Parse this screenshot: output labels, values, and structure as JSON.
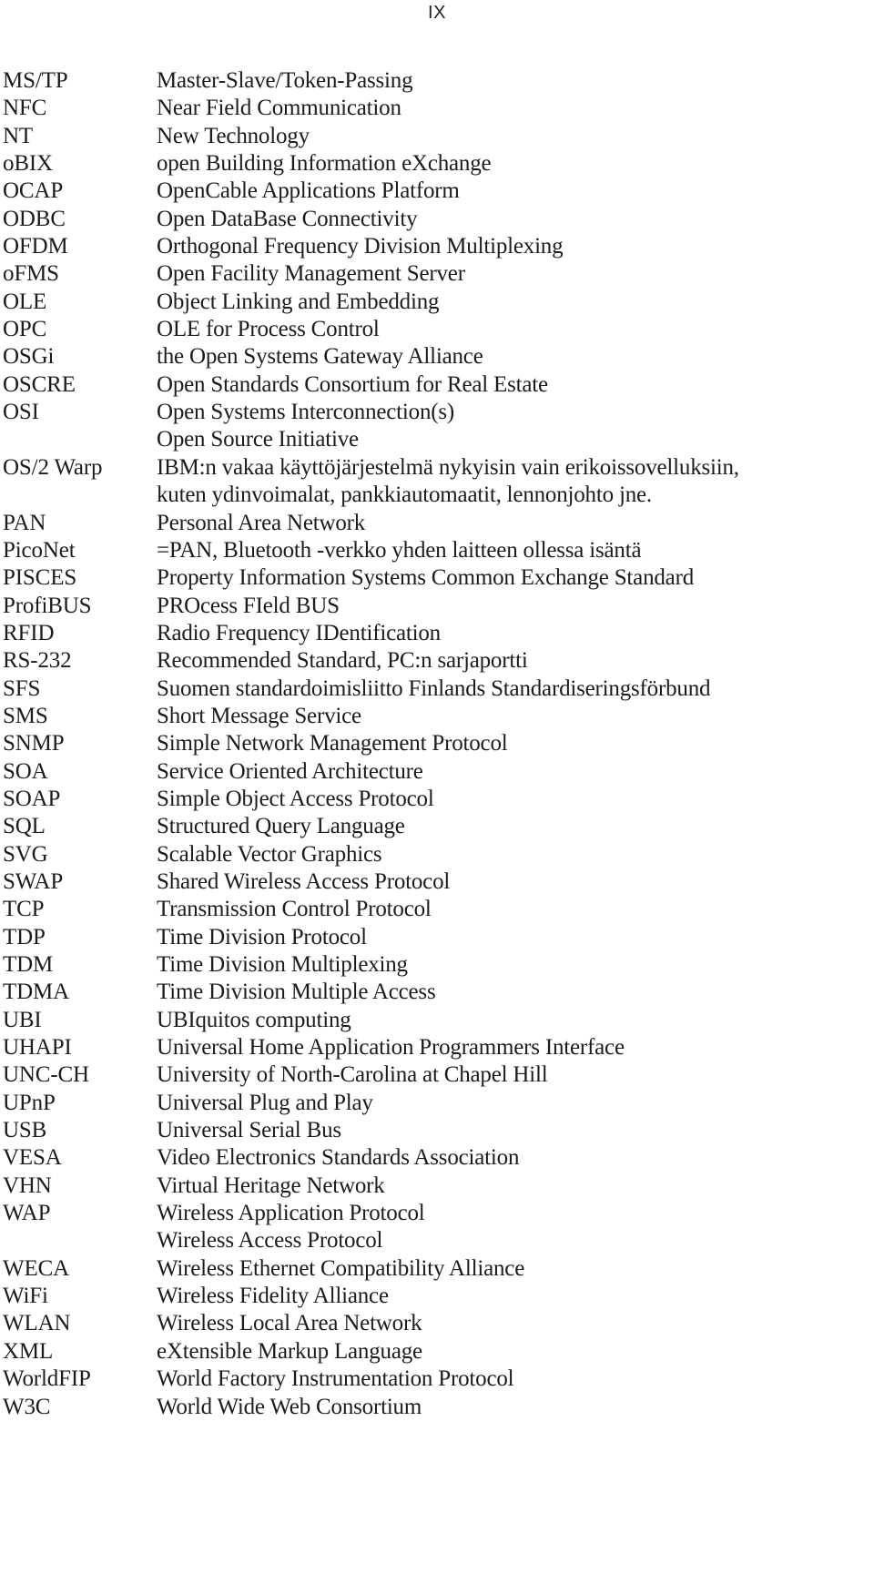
{
  "page": {
    "folio": "IX"
  },
  "glossary": {
    "entries": [
      {
        "abbr": "MS/TP",
        "desc": "Master-Slave/Token-Passing",
        "continuation": false
      },
      {
        "abbr": "NFC",
        "desc": "Near Field Communication",
        "continuation": false
      },
      {
        "abbr": "NT",
        "desc": "New Technology",
        "continuation": false
      },
      {
        "abbr": "oBIX",
        "desc": "open Building Information eXchange",
        "continuation": false
      },
      {
        "abbr": "OCAP",
        "desc": "OpenCable Applications Platform",
        "continuation": false
      },
      {
        "abbr": "ODBC",
        "desc": "Open DataBase Connectivity",
        "continuation": false
      },
      {
        "abbr": "OFDM",
        "desc": "Orthogonal Frequency Division Multiplexing",
        "continuation": false
      },
      {
        "abbr": "oFMS",
        "desc": "Open Facility Management Server",
        "continuation": false
      },
      {
        "abbr": "OLE",
        "desc": "Object Linking and Embedding",
        "continuation": false
      },
      {
        "abbr": "OPC",
        "desc": "OLE for Process Control",
        "continuation": false
      },
      {
        "abbr": "OSGi",
        "desc": "the Open Systems Gateway Alliance",
        "continuation": false
      },
      {
        "abbr": "OSCRE",
        "desc": "Open Standards Consortium for Real Estate",
        "continuation": false
      },
      {
        "abbr": "OSI",
        "desc": "Open Systems Interconnection(s)",
        "continuation": false
      },
      {
        "abbr": "",
        "desc": "Open Source Initiative",
        "continuation": true
      },
      {
        "abbr": "OS/2 Warp",
        "desc": "IBM:n vakaa käyttöjärjestelmä nykyisin vain erikoissovelluksiin,",
        "continuation": false
      },
      {
        "abbr": "",
        "desc": "kuten ydinvoimalat, pankkiautomaatit, lennonjohto jne.",
        "continuation": true
      },
      {
        "abbr": "PAN",
        "desc": "Personal Area Network",
        "continuation": false
      },
      {
        "abbr": "PicoNet",
        "desc": "=PAN, Bluetooth -verkko yhden laitteen ollessa isäntä",
        "continuation": false
      },
      {
        "abbr": "PISCES",
        "desc": "Property Information Systems Common Exchange Standard",
        "continuation": false
      },
      {
        "abbr": "ProfiBUS",
        "desc": "PROcess FIeld BUS",
        "continuation": false
      },
      {
        "abbr": "RFID",
        "desc": "Radio Frequency IDentification",
        "continuation": false
      },
      {
        "abbr": "RS-232",
        "desc": "Recommended Standard, PC:n sarjaportti",
        "continuation": false
      },
      {
        "abbr": "SFS",
        "desc": "Suomen standardoimisliitto Finlands Standardiseringsförbund",
        "continuation": false
      },
      {
        "abbr": "SMS",
        "desc": "Short Message Service",
        "continuation": false
      },
      {
        "abbr": "SNMP",
        "desc": "Simple Network Management Protocol",
        "continuation": false
      },
      {
        "abbr": "SOA",
        "desc": "Service Oriented Architecture",
        "continuation": false
      },
      {
        "abbr": "SOAP",
        "desc": "Simple Object Access Protocol",
        "continuation": false
      },
      {
        "abbr": "SQL",
        "desc": "Structured Query Language",
        "continuation": false
      },
      {
        "abbr": "SVG",
        "desc": "Scalable Vector Graphics",
        "continuation": false
      },
      {
        "abbr": "SWAP",
        "desc": "Shared Wireless Access Protocol",
        "continuation": false
      },
      {
        "abbr": "TCP",
        "desc": "Transmission Control Protocol",
        "continuation": false
      },
      {
        "abbr": "TDP",
        "desc": "Time Division Protocol",
        "continuation": false
      },
      {
        "abbr": "TDM",
        "desc": "Time Division Multiplexing",
        "continuation": false
      },
      {
        "abbr": "TDMA",
        "desc": "Time Division Multiple Access",
        "continuation": false
      },
      {
        "abbr": "UBI",
        "desc": "UBIquitos computing",
        "continuation": false
      },
      {
        "abbr": "UHAPI",
        "desc": "Universal Home Application Programmers Interface",
        "continuation": false
      },
      {
        "abbr": "UNC-CH",
        "desc": "University of North-Carolina at Chapel Hill",
        "continuation": false
      },
      {
        "abbr": "UPnP",
        "desc": "Universal Plug and Play",
        "continuation": false
      },
      {
        "abbr": "USB",
        "desc": "Universal Serial Bus",
        "continuation": false
      },
      {
        "abbr": "VESA",
        "desc": "Video Electronics Standards Association",
        "continuation": false
      },
      {
        "abbr": "VHN",
        "desc": "Virtual Heritage Network",
        "continuation": false
      },
      {
        "abbr": "WAP",
        "desc": "Wireless Application Protocol",
        "continuation": false
      },
      {
        "abbr": "",
        "desc": "Wireless Access Protocol",
        "continuation": true
      },
      {
        "abbr": "WECA",
        "desc": "Wireless Ethernet Compatibility Alliance",
        "continuation": false
      },
      {
        "abbr": "WiFi",
        "desc": "Wireless Fidelity Alliance",
        "continuation": false
      },
      {
        "abbr": "WLAN",
        "desc": "Wireless Local Area Network",
        "continuation": false
      },
      {
        "abbr": "XML",
        "desc": "eXtensible Markup Language",
        "continuation": false
      },
      {
        "abbr": "WorldFIP",
        "desc": "World Factory Instrumentation Protocol",
        "continuation": false
      },
      {
        "abbr": "W3C",
        "desc": "World Wide Web Consortium",
        "continuation": false
      }
    ]
  }
}
